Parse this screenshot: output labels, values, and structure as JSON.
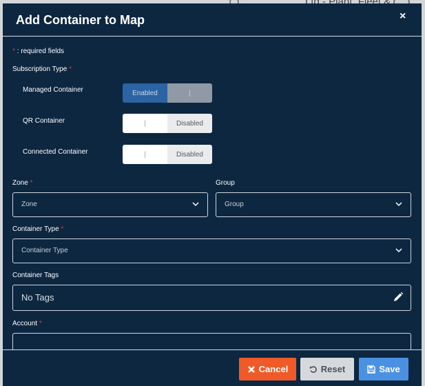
{
  "background": {
    "map_label": "Ltd - Plant_Fleet &"
  },
  "modal": {
    "title": "Add Container to Map",
    "close_label": "×",
    "required_star": "*",
    "required_note": ": required fields"
  },
  "subscription": {
    "label": "Subscription Type",
    "managed": {
      "label": "Managed Container",
      "state": "Enabled",
      "handle": "|"
    },
    "qr": {
      "label": "QR Container",
      "state": "Disabled",
      "handle": "|"
    },
    "connected": {
      "label": "Connected Container",
      "state": "Disabled",
      "handle": "|"
    }
  },
  "zone": {
    "label": "Zone",
    "placeholder": "Zone"
  },
  "group": {
    "label": "Group",
    "placeholder": "Group"
  },
  "container_type": {
    "label": "Container Type",
    "placeholder": "Container Type"
  },
  "container_tags": {
    "label": "Container Tags",
    "value": "No Tags"
  },
  "account": {
    "label": "Account"
  },
  "footer": {
    "cancel": "Cancel",
    "reset": "Reset",
    "save": "Save"
  },
  "colors": {
    "modal_bg": "#0d2741",
    "cancel": "#f05a28",
    "reset": "#d6d9dc",
    "save": "#4a91e2",
    "enabled": "#2b63a3",
    "required": "#e03b2a"
  }
}
